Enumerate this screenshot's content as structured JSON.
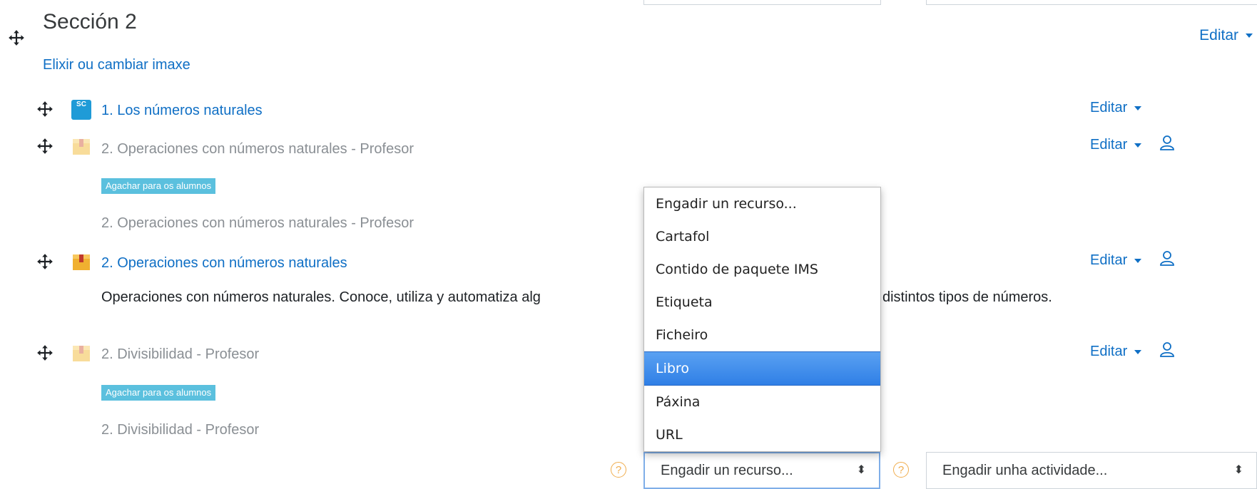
{
  "section": {
    "title": "Sección 2",
    "edit_label": "Editar",
    "image_link": "Elixir ou cambiar imaxe"
  },
  "activities": [
    {
      "title": "1. Los números naturales",
      "edit_label": "Editar",
      "icon": "scorm-package-icon",
      "icon_text": "SC"
    },
    {
      "title": "2. Operaciones con números naturales - Profesor",
      "edit_label": "Editar",
      "icon": "package-icon",
      "badge": "Agachar para os alumnos",
      "sub": "2. Operaciones con números naturales - Profesor"
    },
    {
      "title": "2. Operaciones con números naturales",
      "edit_label": "Editar",
      "icon": "package-icon",
      "description": "Operaciones con números naturales. Conoce, utiliza y automatiza alg                                    ta, multiplicación y división con distintos tipos de números."
    },
    {
      "title": "2. Divisibilidad - Profesor",
      "edit_label": "Editar",
      "icon": "package-icon",
      "badge": "Agachar para os alumnos",
      "sub": "2. Divisibilidad - Profesor"
    }
  ],
  "resource_menu": {
    "items": [
      "Engadir un recurso...",
      "Cartafol",
      "Contido de paquete IMS",
      "Etiqueta",
      "Ficheiro",
      "Libro",
      "Páxina",
      "URL"
    ],
    "selected": "Libro"
  },
  "add_resource_select": {
    "value": "Engadir un recurso..."
  },
  "add_activity_select": {
    "value": "Engadir unha actividade..."
  },
  "help_symbol": "?",
  "select_arrows": "⬍",
  "colors": {
    "link": "#0f6fc5",
    "badge": "#5bc0de",
    "menu_selected": "#3a86ea",
    "help": "#f0ad4e"
  }
}
